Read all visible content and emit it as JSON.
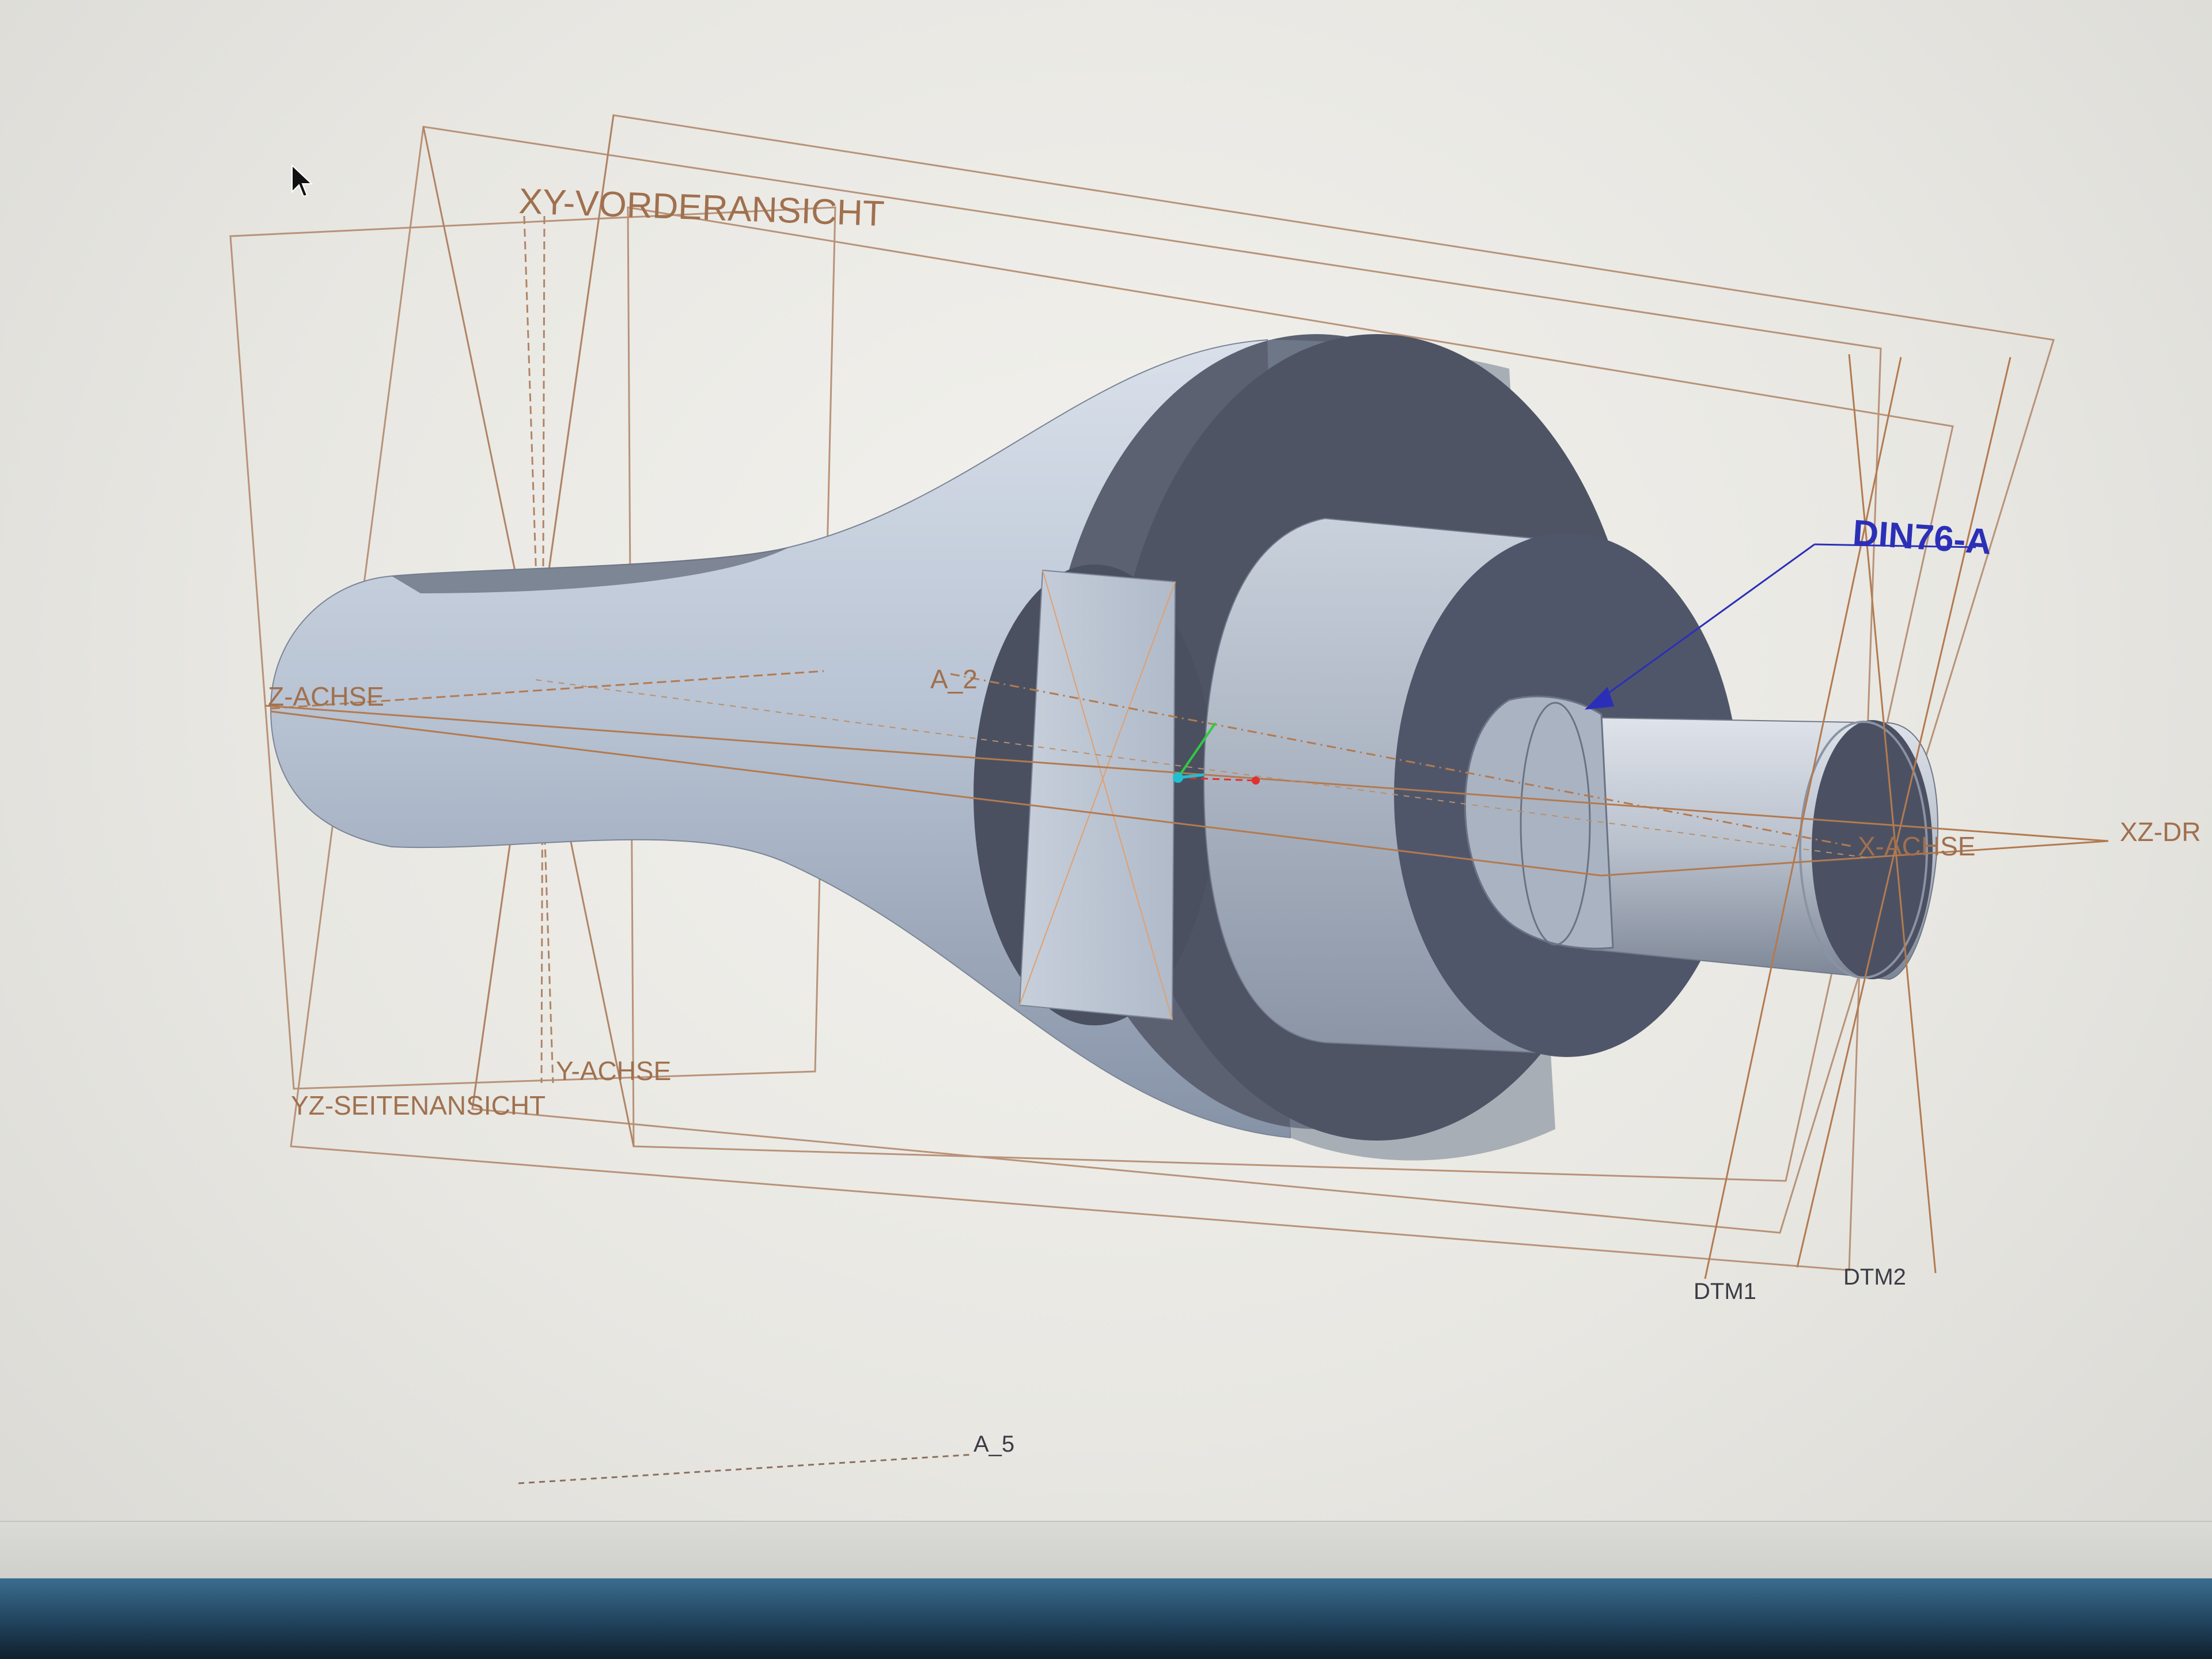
{
  "viewport": {
    "datum_planes": {
      "front": "XY-VORDERANSICHT",
      "side": "YZ-SEITENANSICHT",
      "top_partial": "XZ-DR",
      "dtm1": "DTM1",
      "dtm2": "DTM2"
    },
    "axes": {
      "z": "Z-ACHSE",
      "y": "Y-ACHSE",
      "x": "X-ACHSE",
      "a2": "A_2",
      "a5": "A_5"
    },
    "annotation": "DIN76-A"
  },
  "colors": {
    "datum": "#b07a52",
    "annotation": "#2b2fb8",
    "part_light": "#c4cedc",
    "part_dark": "#4f5565",
    "background": "#ebeae6"
  }
}
